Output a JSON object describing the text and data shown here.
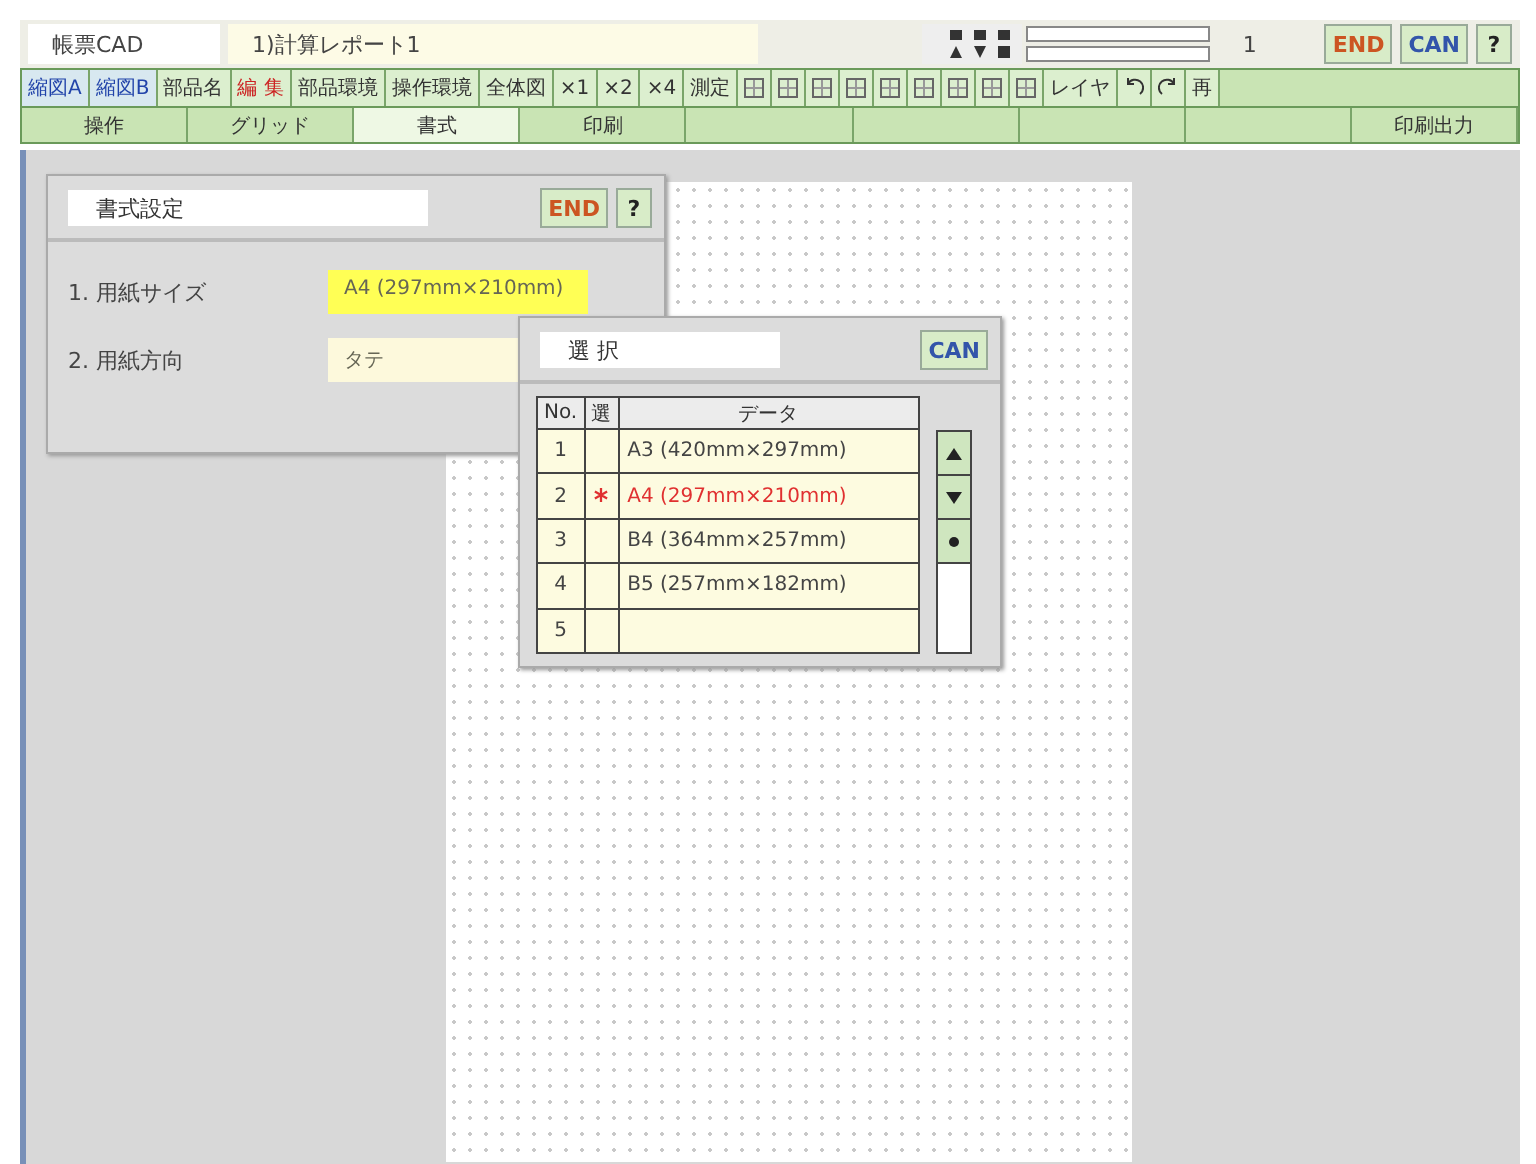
{
  "header": {
    "app_name": "帳票CAD",
    "document": "1)計算レポート1",
    "counter": "1",
    "buttons": [
      {
        "label": "END",
        "kind": "end"
      },
      {
        "label": "CAN",
        "kind": "can"
      },
      {
        "label": "?",
        "kind": "help"
      }
    ]
  },
  "toolbar": [
    {
      "label": "縮図A",
      "kind": "blue"
    },
    {
      "label": "縮図B",
      "kind": "blue"
    },
    {
      "label": "部品名",
      "kind": "text"
    },
    {
      "label": "編 集",
      "kind": "red"
    },
    {
      "label": "部品環境",
      "kind": "text"
    },
    {
      "label": "操作環境",
      "kind": "text"
    },
    {
      "label": "全体図",
      "kind": "text"
    },
    {
      "label": "×1",
      "kind": "text"
    },
    {
      "label": "×2",
      "kind": "text"
    },
    {
      "label": "×4",
      "kind": "text"
    },
    {
      "label": "測定",
      "kind": "text"
    },
    {
      "kind": "icon"
    },
    {
      "kind": "icon"
    },
    {
      "kind": "icon"
    },
    {
      "kind": "icon"
    },
    {
      "kind": "icon"
    },
    {
      "kind": "icon"
    },
    {
      "kind": "icon"
    },
    {
      "kind": "icon"
    },
    {
      "kind": "icon"
    },
    {
      "label": "レイヤ",
      "kind": "text"
    },
    {
      "kind": "undo"
    },
    {
      "kind": "redo"
    },
    {
      "label": "再",
      "kind": "text"
    }
  ],
  "tabs": [
    {
      "label": "操作",
      "selected": false
    },
    {
      "label": "グリッド",
      "selected": false
    },
    {
      "label": "書式",
      "selected": true
    },
    {
      "label": "印刷",
      "selected": false
    },
    {
      "selected": false
    },
    {
      "selected": false
    },
    {
      "selected": false
    },
    {
      "selected": false
    },
    {
      "label": "印刷出力",
      "selected": false
    }
  ],
  "format_dialog": {
    "title": "書式設定",
    "buttons": [
      {
        "label": "END",
        "kind": "end"
      },
      {
        "label": "?",
        "kind": "help"
      }
    ],
    "fields": [
      {
        "label": "1. 用紙サイズ",
        "value": "A4 (297mm×210mm)",
        "active": true
      },
      {
        "label": "2. 用紙方向",
        "value": "タテ",
        "active": false
      }
    ]
  },
  "select_dialog": {
    "title": "選 択",
    "cancel": "CAN",
    "columns": [
      "No.",
      "選",
      "データ"
    ],
    "rows": [
      {
        "no": "1",
        "data": "A3 (420mm×297mm)",
        "selected": false
      },
      {
        "no": "2",
        "data": "A4 (297mm×210mm)",
        "selected": true
      },
      {
        "no": "3",
        "data": "B4 (364mm×257mm)",
        "selected": false
      },
      {
        "no": "4",
        "data": "B5 (257mm×182mm)",
        "selected": false
      },
      {
        "no": "5",
        "selected": false
      }
    ]
  }
}
